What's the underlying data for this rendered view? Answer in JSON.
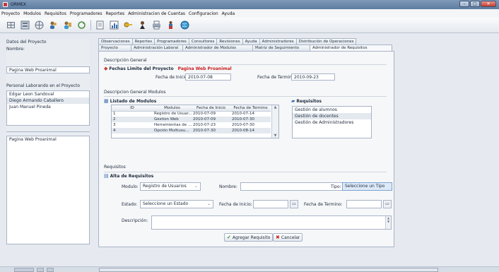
{
  "window": {
    "title": "ORMEX"
  },
  "menubar": [
    "Proyecto",
    "Modulos",
    "Requisitos",
    "Programadores",
    "Reportes",
    "Administracion de Cuentas",
    "Configuracion",
    "Ayuda"
  ],
  "toolbar": {
    "icons": [
      "grid-icon",
      "list-icon",
      "globe-icon",
      "users-icon",
      "users-edit-icon",
      "refresh-icon",
      "doc-icon",
      "chart-icon",
      "key-icon",
      "person-icon",
      "printer-icon",
      "person-group-icon",
      "globe-blue-icon"
    ]
  },
  "left": {
    "datos_label": "Datos del Proyecto",
    "nombre_label": "Nombre:",
    "nombre_value": "Pagina Web Proanimal",
    "personal_label": "Personal Laborando en el Proyecto",
    "personal": [
      "Edgar Leon Sandoval",
      "Diego Armando Caballero",
      "Juan Manuel Pineda"
    ],
    "project_list_item": "Pagina Web Proanimal"
  },
  "tabs": {
    "row1": [
      "Observaciones",
      "Reportes",
      "Programadores",
      "Consultores",
      "Revisiones",
      "Ayuda",
      "Administradores",
      "Distribución de Operaciones"
    ],
    "row2": [
      "Proyecto",
      "Administración Laboral",
      "Administrador de Modulos",
      "Matriz de Seguimiento",
      "Administrador de Requisitos"
    ]
  },
  "general": {
    "title": "Descripción General",
    "fechas_label": "Fechas Limite del Proyecto",
    "project_name": "Pagina Web Proanimal",
    "inicio_label": "Fecha de Inicio:",
    "inicio_value": "2010-07-08",
    "termino_label": "Fecha de Termino:",
    "termino_value": "2010-09-23"
  },
  "modulos": {
    "section_title": "Descripcion General Modulos",
    "listado_title": "Listado de Modulos",
    "columns": [
      "ID",
      "Modulos",
      "Fecha de Inicio",
      "Fecha de Termino"
    ],
    "rows": [
      [
        "1",
        "Registro de Usuar...",
        "2010-07-09",
        "2010-07-14"
      ],
      [
        "2",
        "Gestion Web",
        "2010-07-09",
        "2010-07-30"
      ],
      [
        "3",
        "Herramientas de ...",
        "2010-07-23",
        "2010-07-30"
      ],
      [
        "4",
        "Opción Multiusu...",
        "2010-07-30",
        "2010-08-14"
      ]
    ],
    "requisitos_title": "Requisitos",
    "requisitos": [
      "Gestión de alumnos",
      "Gestión de docentes",
      "Gestión de Administradores"
    ]
  },
  "requisitos_form": {
    "section_title": "Requisitos",
    "alta_title": "Alta de Requisitos",
    "modulo_label": "Modulo:",
    "modulo_value": "Registro de Usuarios",
    "nombre_label": "Nombre:",
    "nombre_value": "",
    "tipo_label": "Tipo:",
    "tipo_value": "Seleccione un Tipo",
    "estado_label": "Estado:",
    "estado_value": "Seleccione un Estado",
    "inicio_label": "Fecha de Inicio:",
    "termino_label": "Fecha de Termino:",
    "descripcion_label": "Descripción:",
    "agregar_label": "Agregar Requisito",
    "cancelar_label": "Cancelar"
  }
}
